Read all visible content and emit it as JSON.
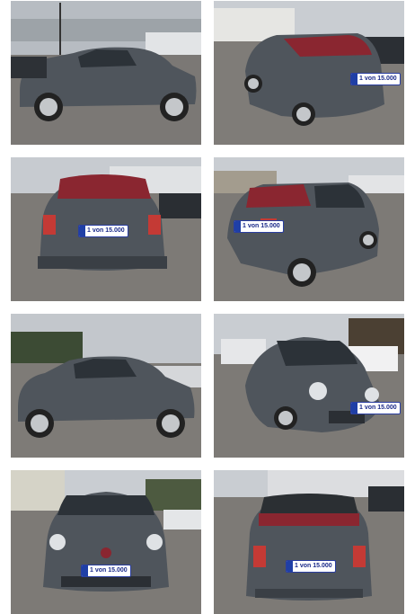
{
  "gallery": {
    "photos": [
      {
        "alt": "Fiat 500 side view left, grey, street scene"
      },
      {
        "alt": "Fiat 500 convertible rear three-quarter view"
      },
      {
        "alt": "Fiat 500 rear view with red top"
      },
      {
        "alt": "Fiat 500 rear three-quarter view right"
      },
      {
        "alt": "Fiat 500 side view left, in car lot"
      },
      {
        "alt": "Fiat 500 front three-quarter view"
      },
      {
        "alt": "Fiat 500 front view"
      },
      {
        "alt": "Fiat 500 rear view with roof open"
      }
    ],
    "plate_text": "1 von 15.000"
  },
  "colors": {
    "car_body": "#4f555c",
    "roof_red": "#8a2630",
    "sky": "#c9cdd2",
    "pavement": "#7d7a76"
  }
}
